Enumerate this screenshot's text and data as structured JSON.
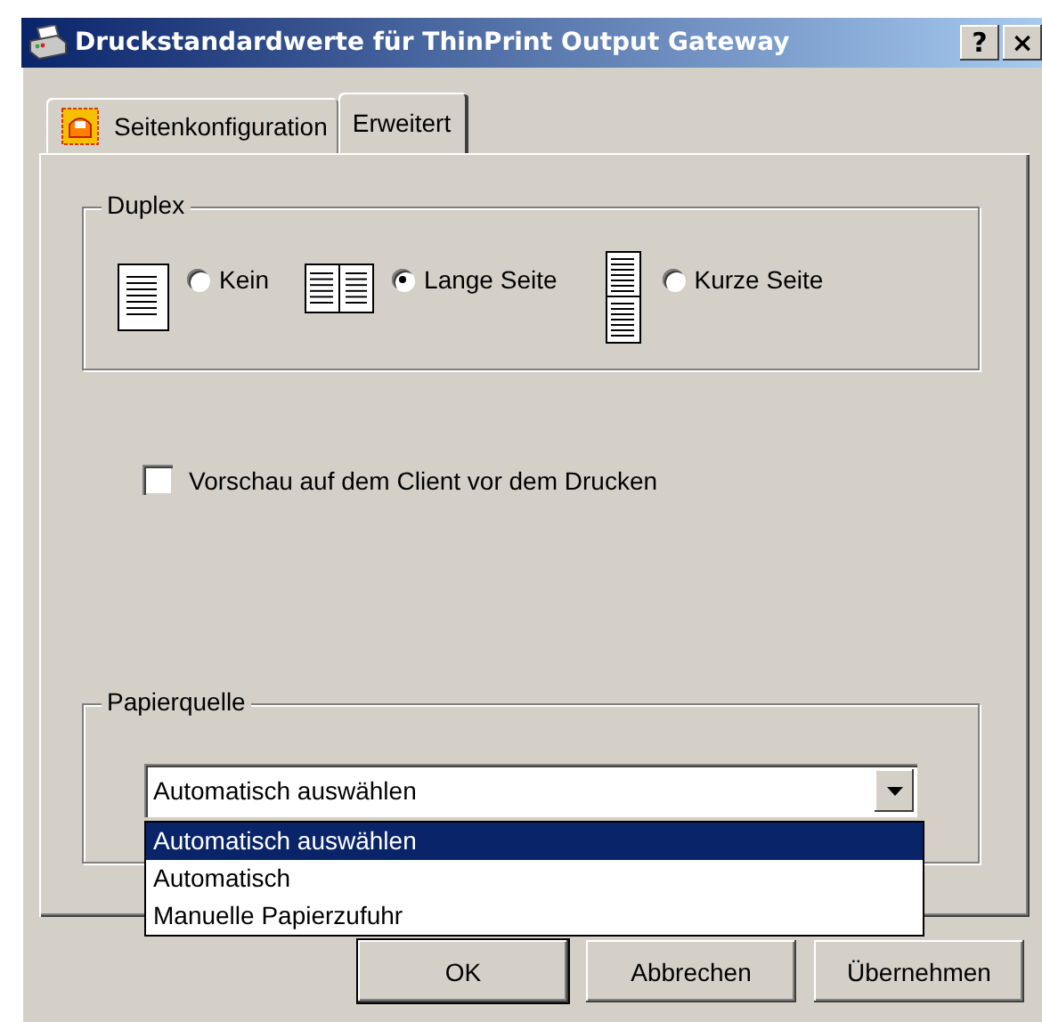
{
  "window": {
    "title": "Druckstandardwerte für ThinPrint Output Gateway",
    "help_button": "?",
    "close_button": "×"
  },
  "tabs": [
    {
      "label": "Seitenkonfiguration",
      "selected": false,
      "has_icon": true
    },
    {
      "label": "Erweitert",
      "selected": true,
      "has_icon": false
    }
  ],
  "duplex": {
    "legend": "Duplex",
    "options": [
      {
        "label": "Kein",
        "kind": "single",
        "selected": false
      },
      {
        "label": "Lange Seite",
        "kind": "long",
        "selected": true
      },
      {
        "label": "Kurze Seite",
        "kind": "short",
        "selected": false
      }
    ]
  },
  "preview": {
    "label": "Vorschau auf dem Client vor dem Drucken",
    "checked": false
  },
  "paper_source": {
    "legend": "Papierquelle",
    "value": "Automatisch auswählen",
    "expanded": true,
    "options": [
      {
        "label": "Automatisch auswählen",
        "selected": true
      },
      {
        "label": "Automatisch",
        "selected": false
      },
      {
        "label": "Manuelle Papierzufuhr",
        "selected": false
      }
    ]
  },
  "buttons": [
    {
      "label": "OK",
      "default": true
    },
    {
      "label": "Abbrechen",
      "default": false
    },
    {
      "label": "Übernehmen",
      "default": false
    }
  ]
}
